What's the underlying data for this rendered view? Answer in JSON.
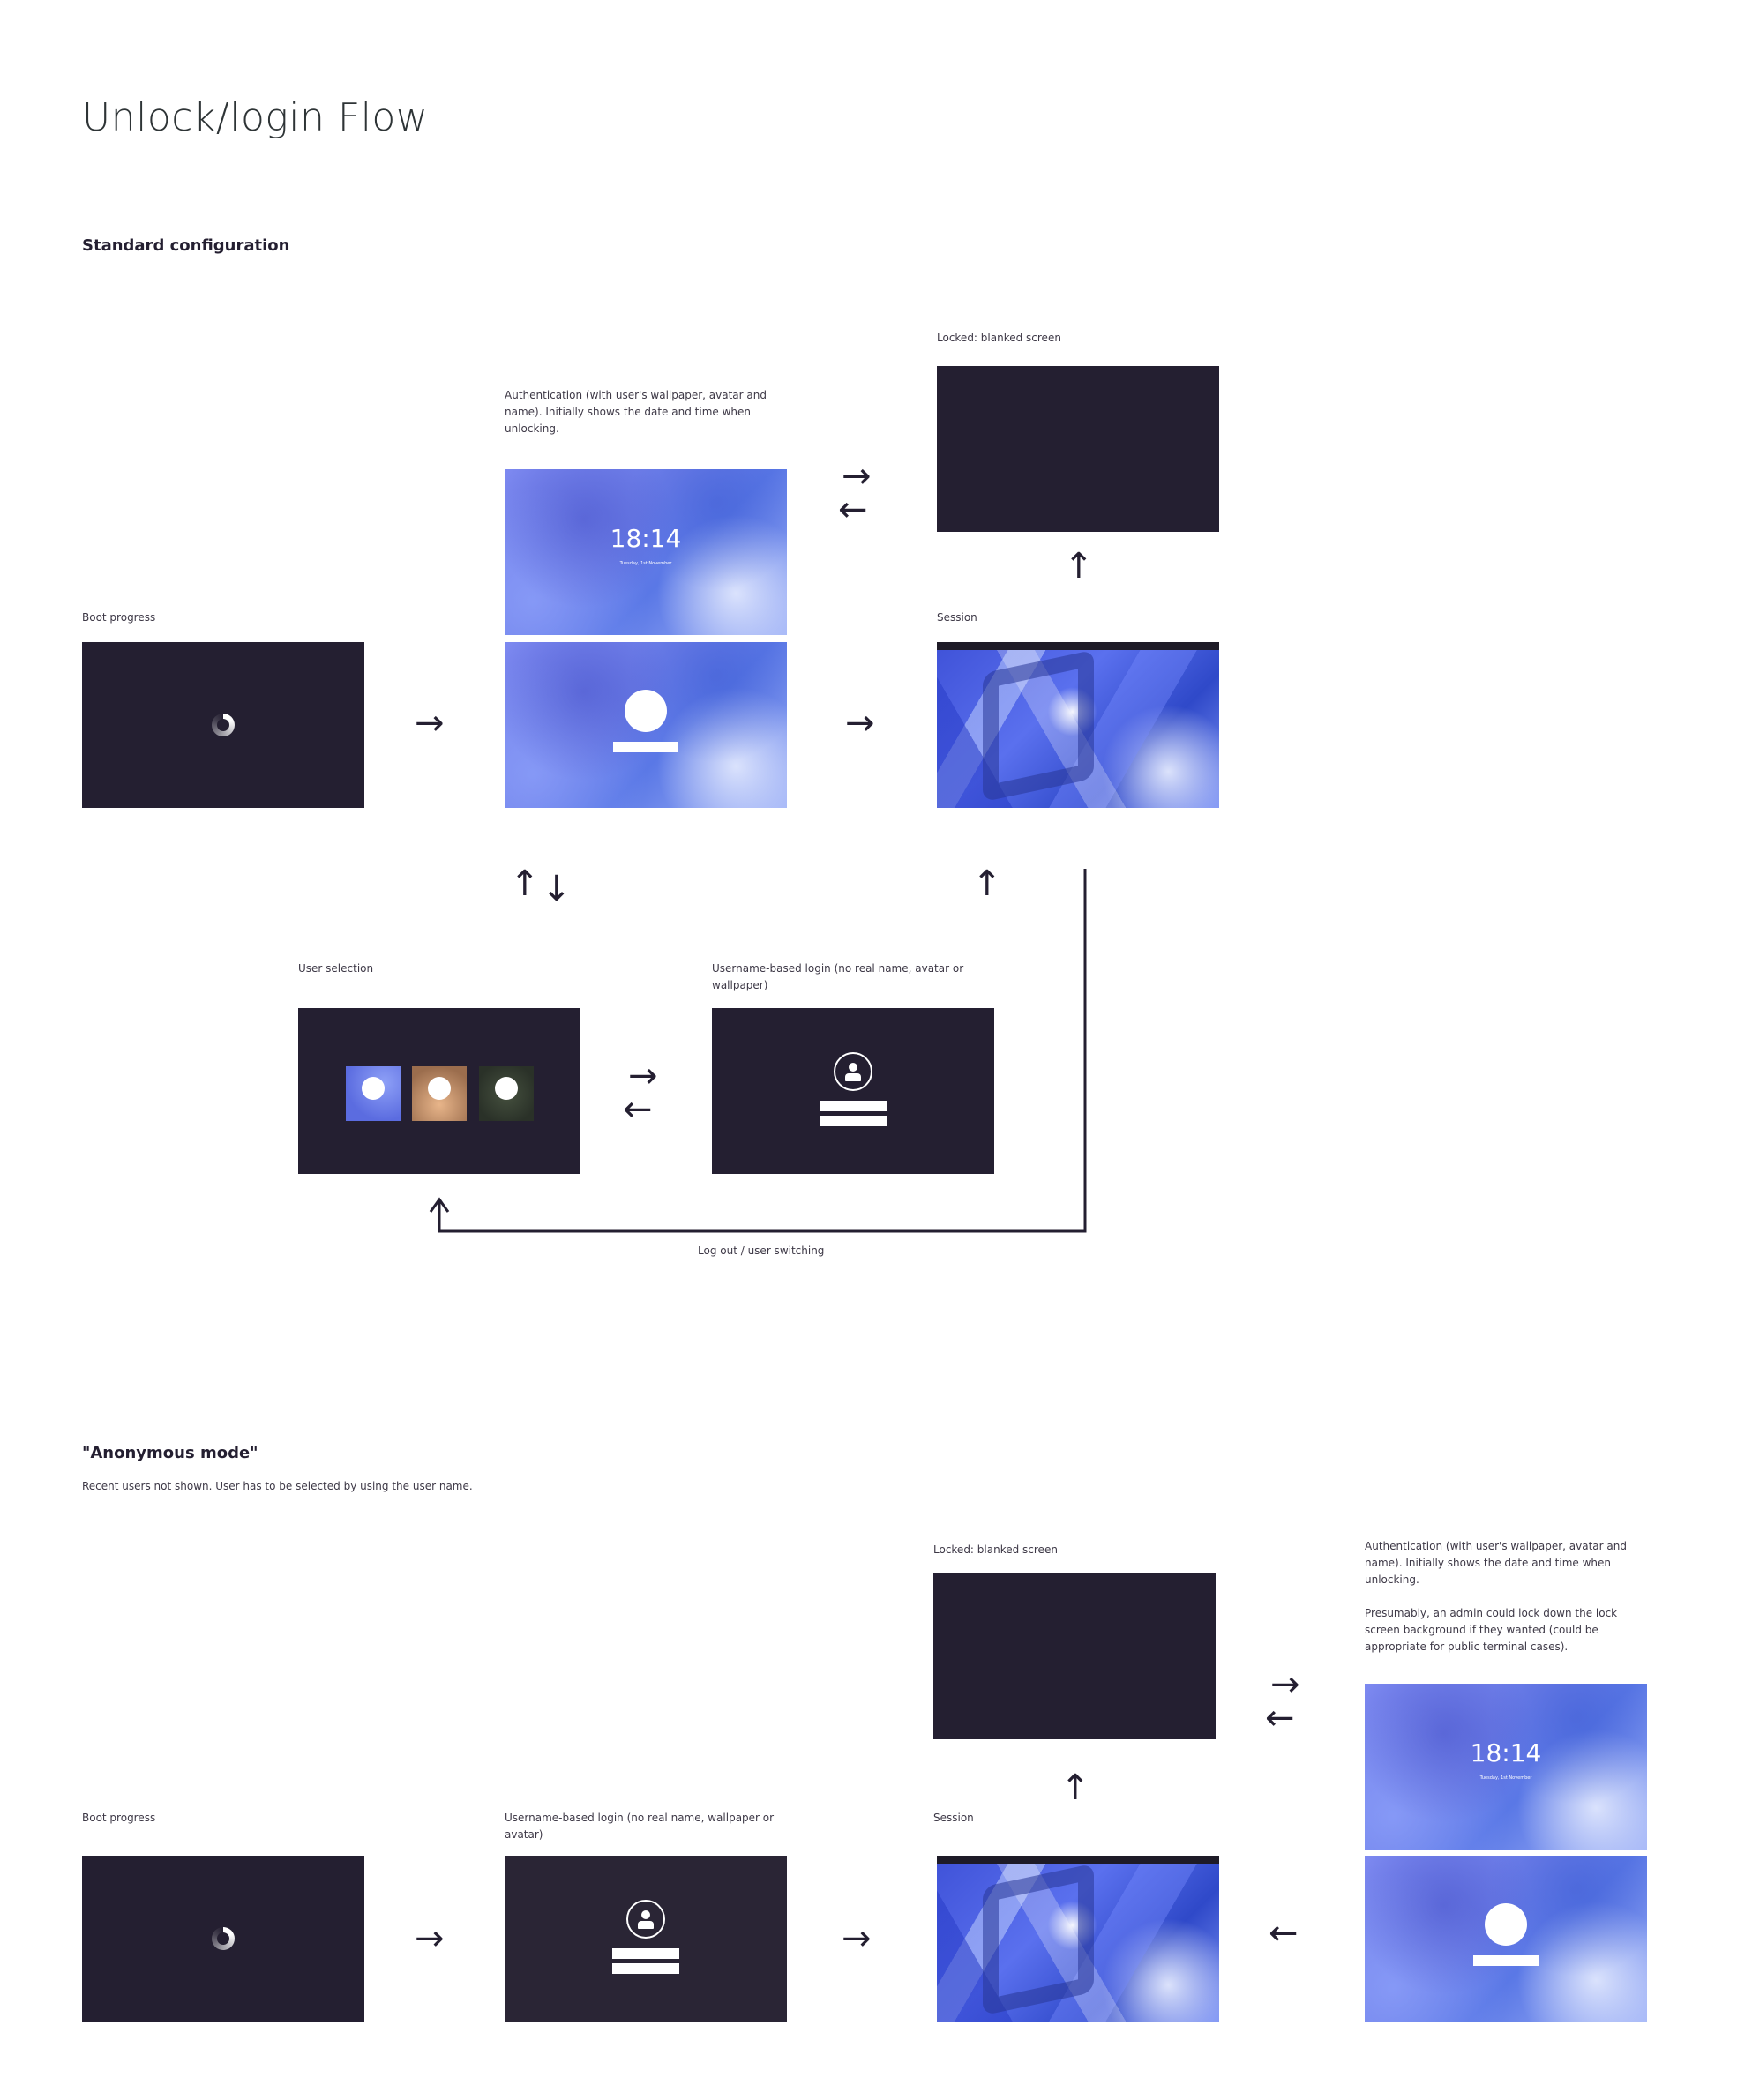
{
  "page_title": "Unlock/login Flow",
  "standard": {
    "heading": "Standard configuration",
    "boot_label": "Boot progress",
    "auth_label": "Authentication (with user's wallpaper, avatar and name). Initially shows the date and time when unlocking.",
    "clock_time": "18:14",
    "clock_date": "Tuesday, 1st November",
    "locked_label": "Locked: blanked screen",
    "session_label": "Session",
    "user_selection_label": "User selection",
    "username_login_label": "Username-based login (no real name, avatar or wallpaper)",
    "logout_label": "Log out / user switching"
  },
  "anonymous": {
    "heading": "\"Anonymous mode\"",
    "description": "Recent users not shown. User has to be selected by using the user name.",
    "locked_label": "Locked: blanked screen",
    "auth_label": "Authentication (with user's wallpaper, avatar and name). Initially shows the date and time when unlocking.",
    "auth_note": "Presumably, an admin could lock down the lock screen background if they wanted (could be appropriate for public terminal cases).",
    "boot_label": "Boot progress",
    "username_login_label": "Username-based login (no real name, wallpaper or avatar)",
    "session_label": "Session",
    "clock_time": "18:14",
    "clock_date": "Tuesday, 1st November"
  },
  "arrows": {
    "right": "→",
    "left": "←",
    "up": "↑",
    "down": "↓"
  },
  "colors": {
    "screen_dark": "#241f31",
    "text": "#241f31",
    "wallpaper_blue": "#6b7de8"
  },
  "icons": [
    "spinner-icon",
    "user-icon",
    "avatar-placeholder"
  ]
}
